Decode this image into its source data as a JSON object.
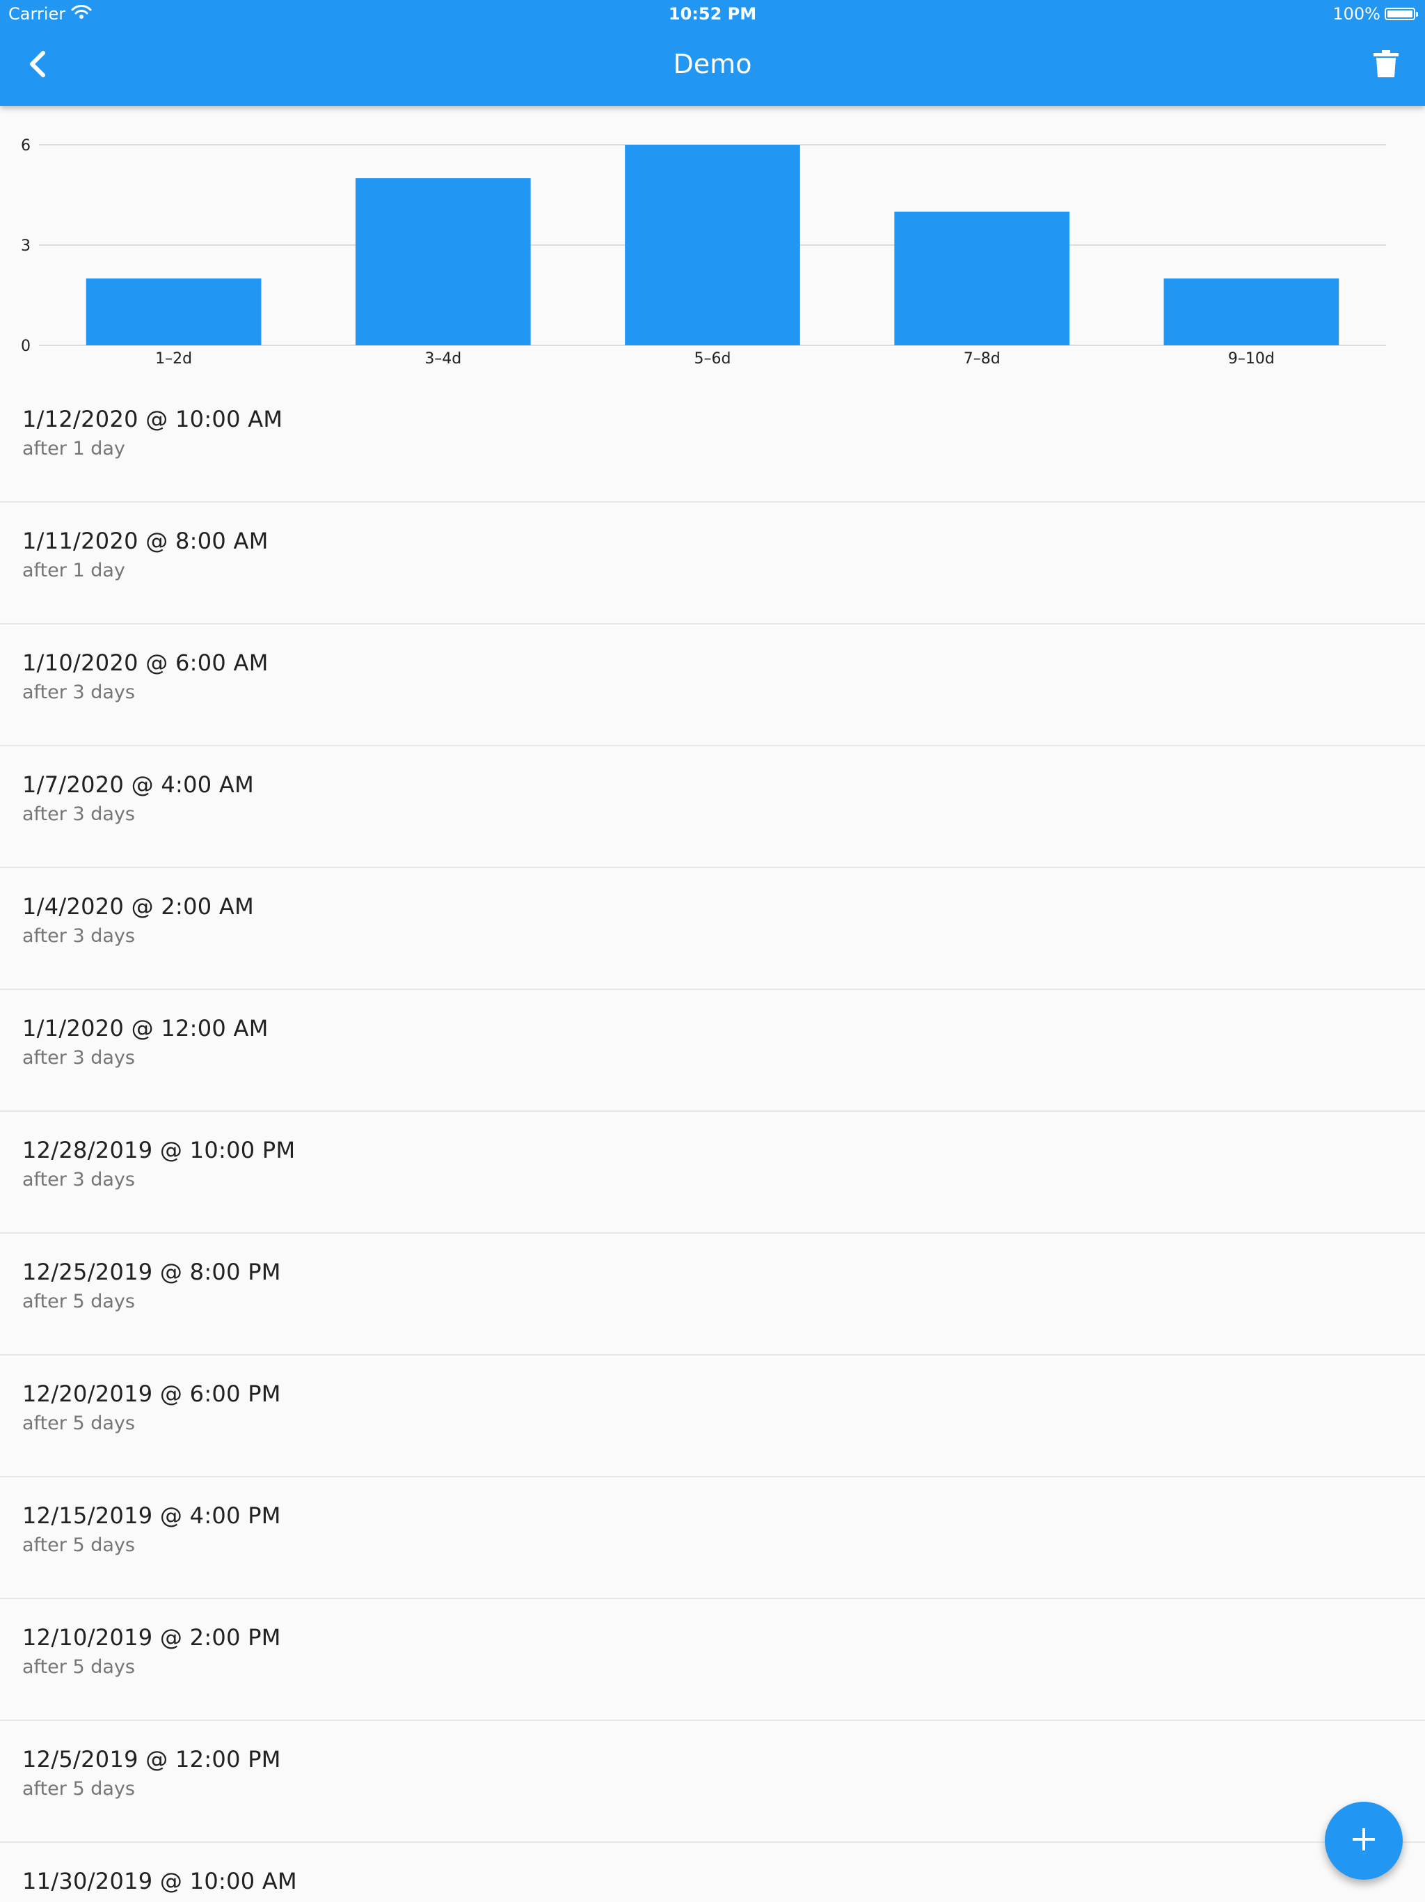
{
  "status_bar": {
    "carrier": "Carrier",
    "time": "10:52 PM",
    "battery": "100%",
    "battery_level": 1.0
  },
  "app_bar": {
    "title": "Demo",
    "back_icon": "chevron-left-icon",
    "delete_icon": "trash-icon",
    "color": "#2196f3"
  },
  "chart_data": {
    "type": "bar",
    "categories": [
      "1–2d",
      "3–4d",
      "5–6d",
      "7–8d",
      "9–10d"
    ],
    "values": [
      2,
      5,
      6,
      4,
      2
    ],
    "yticks": [
      "0",
      "3",
      "6"
    ],
    "ylim": [
      0,
      6
    ],
    "grid": true,
    "bar_color": "#2196f3",
    "title": "",
    "xlabel": "",
    "ylabel": ""
  },
  "entries": [
    {
      "datetime": "1/12/2020 @ 10:00 AM",
      "detail": "after 1 day"
    },
    {
      "datetime": "1/11/2020 @ 8:00 AM",
      "detail": "after 1 day"
    },
    {
      "datetime": "1/10/2020 @ 6:00 AM",
      "detail": "after 3 days"
    },
    {
      "datetime": "1/7/2020 @ 4:00 AM",
      "detail": "after 3 days"
    },
    {
      "datetime": "1/4/2020 @ 2:00 AM",
      "detail": "after 3 days"
    },
    {
      "datetime": "1/1/2020 @ 12:00 AM",
      "detail": "after 3 days"
    },
    {
      "datetime": "12/28/2019 @ 10:00 PM",
      "detail": "after 3 days"
    },
    {
      "datetime": "12/25/2019 @ 8:00 PM",
      "detail": "after 5 days"
    },
    {
      "datetime": "12/20/2019 @ 6:00 PM",
      "detail": "after 5 days"
    },
    {
      "datetime": "12/15/2019 @ 4:00 PM",
      "detail": "after 5 days"
    },
    {
      "datetime": "12/10/2019 @ 2:00 PM",
      "detail": "after 5 days"
    },
    {
      "datetime": "12/5/2019 @ 12:00 PM",
      "detail": "after 5 days"
    },
    {
      "datetime": "11/30/2019 @ 10:00 AM",
      "detail": ""
    }
  ],
  "fab": {
    "icon": "plus-icon",
    "color": "#2196f3"
  }
}
